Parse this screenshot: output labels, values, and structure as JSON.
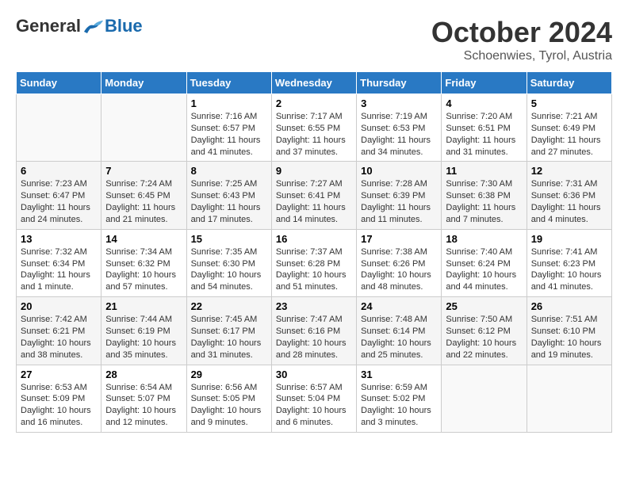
{
  "header": {
    "logo_general": "General",
    "logo_blue": "Blue",
    "month_title": "October 2024",
    "subtitle": "Schoenwies, Tyrol, Austria"
  },
  "days_of_week": [
    "Sunday",
    "Monday",
    "Tuesday",
    "Wednesday",
    "Thursday",
    "Friday",
    "Saturday"
  ],
  "weeks": [
    [
      {
        "day": "",
        "sunrise": "",
        "sunset": "",
        "daylight": ""
      },
      {
        "day": "",
        "sunrise": "",
        "sunset": "",
        "daylight": ""
      },
      {
        "day": "1",
        "sunrise": "Sunrise: 7:16 AM",
        "sunset": "Sunset: 6:57 PM",
        "daylight": "Daylight: 11 hours and 41 minutes."
      },
      {
        "day": "2",
        "sunrise": "Sunrise: 7:17 AM",
        "sunset": "Sunset: 6:55 PM",
        "daylight": "Daylight: 11 hours and 37 minutes."
      },
      {
        "day": "3",
        "sunrise": "Sunrise: 7:19 AM",
        "sunset": "Sunset: 6:53 PM",
        "daylight": "Daylight: 11 hours and 34 minutes."
      },
      {
        "day": "4",
        "sunrise": "Sunrise: 7:20 AM",
        "sunset": "Sunset: 6:51 PM",
        "daylight": "Daylight: 11 hours and 31 minutes."
      },
      {
        "day": "5",
        "sunrise": "Sunrise: 7:21 AM",
        "sunset": "Sunset: 6:49 PM",
        "daylight": "Daylight: 11 hours and 27 minutes."
      }
    ],
    [
      {
        "day": "6",
        "sunrise": "Sunrise: 7:23 AM",
        "sunset": "Sunset: 6:47 PM",
        "daylight": "Daylight: 11 hours and 24 minutes."
      },
      {
        "day": "7",
        "sunrise": "Sunrise: 7:24 AM",
        "sunset": "Sunset: 6:45 PM",
        "daylight": "Daylight: 11 hours and 21 minutes."
      },
      {
        "day": "8",
        "sunrise": "Sunrise: 7:25 AM",
        "sunset": "Sunset: 6:43 PM",
        "daylight": "Daylight: 11 hours and 17 minutes."
      },
      {
        "day": "9",
        "sunrise": "Sunrise: 7:27 AM",
        "sunset": "Sunset: 6:41 PM",
        "daylight": "Daylight: 11 hours and 14 minutes."
      },
      {
        "day": "10",
        "sunrise": "Sunrise: 7:28 AM",
        "sunset": "Sunset: 6:39 PM",
        "daylight": "Daylight: 11 hours and 11 minutes."
      },
      {
        "day": "11",
        "sunrise": "Sunrise: 7:30 AM",
        "sunset": "Sunset: 6:38 PM",
        "daylight": "Daylight: 11 hours and 7 minutes."
      },
      {
        "day": "12",
        "sunrise": "Sunrise: 7:31 AM",
        "sunset": "Sunset: 6:36 PM",
        "daylight": "Daylight: 11 hours and 4 minutes."
      }
    ],
    [
      {
        "day": "13",
        "sunrise": "Sunrise: 7:32 AM",
        "sunset": "Sunset: 6:34 PM",
        "daylight": "Daylight: 11 hours and 1 minute."
      },
      {
        "day": "14",
        "sunrise": "Sunrise: 7:34 AM",
        "sunset": "Sunset: 6:32 PM",
        "daylight": "Daylight: 10 hours and 57 minutes."
      },
      {
        "day": "15",
        "sunrise": "Sunrise: 7:35 AM",
        "sunset": "Sunset: 6:30 PM",
        "daylight": "Daylight: 10 hours and 54 minutes."
      },
      {
        "day": "16",
        "sunrise": "Sunrise: 7:37 AM",
        "sunset": "Sunset: 6:28 PM",
        "daylight": "Daylight: 10 hours and 51 minutes."
      },
      {
        "day": "17",
        "sunrise": "Sunrise: 7:38 AM",
        "sunset": "Sunset: 6:26 PM",
        "daylight": "Daylight: 10 hours and 48 minutes."
      },
      {
        "day": "18",
        "sunrise": "Sunrise: 7:40 AM",
        "sunset": "Sunset: 6:24 PM",
        "daylight": "Daylight: 10 hours and 44 minutes."
      },
      {
        "day": "19",
        "sunrise": "Sunrise: 7:41 AM",
        "sunset": "Sunset: 6:23 PM",
        "daylight": "Daylight: 10 hours and 41 minutes."
      }
    ],
    [
      {
        "day": "20",
        "sunrise": "Sunrise: 7:42 AM",
        "sunset": "Sunset: 6:21 PM",
        "daylight": "Daylight: 10 hours and 38 minutes."
      },
      {
        "day": "21",
        "sunrise": "Sunrise: 7:44 AM",
        "sunset": "Sunset: 6:19 PM",
        "daylight": "Daylight: 10 hours and 35 minutes."
      },
      {
        "day": "22",
        "sunrise": "Sunrise: 7:45 AM",
        "sunset": "Sunset: 6:17 PM",
        "daylight": "Daylight: 10 hours and 31 minutes."
      },
      {
        "day": "23",
        "sunrise": "Sunrise: 7:47 AM",
        "sunset": "Sunset: 6:16 PM",
        "daylight": "Daylight: 10 hours and 28 minutes."
      },
      {
        "day": "24",
        "sunrise": "Sunrise: 7:48 AM",
        "sunset": "Sunset: 6:14 PM",
        "daylight": "Daylight: 10 hours and 25 minutes."
      },
      {
        "day": "25",
        "sunrise": "Sunrise: 7:50 AM",
        "sunset": "Sunset: 6:12 PM",
        "daylight": "Daylight: 10 hours and 22 minutes."
      },
      {
        "day": "26",
        "sunrise": "Sunrise: 7:51 AM",
        "sunset": "Sunset: 6:10 PM",
        "daylight": "Daylight: 10 hours and 19 minutes."
      }
    ],
    [
      {
        "day": "27",
        "sunrise": "Sunrise: 6:53 AM",
        "sunset": "Sunset: 5:09 PM",
        "daylight": "Daylight: 10 hours and 16 minutes."
      },
      {
        "day": "28",
        "sunrise": "Sunrise: 6:54 AM",
        "sunset": "Sunset: 5:07 PM",
        "daylight": "Daylight: 10 hours and 12 minutes."
      },
      {
        "day": "29",
        "sunrise": "Sunrise: 6:56 AM",
        "sunset": "Sunset: 5:05 PM",
        "daylight": "Daylight: 10 hours and 9 minutes."
      },
      {
        "day": "30",
        "sunrise": "Sunrise: 6:57 AM",
        "sunset": "Sunset: 5:04 PM",
        "daylight": "Daylight: 10 hours and 6 minutes."
      },
      {
        "day": "31",
        "sunrise": "Sunrise: 6:59 AM",
        "sunset": "Sunset: 5:02 PM",
        "daylight": "Daylight: 10 hours and 3 minutes."
      },
      {
        "day": "",
        "sunrise": "",
        "sunset": "",
        "daylight": ""
      },
      {
        "day": "",
        "sunrise": "",
        "sunset": "",
        "daylight": ""
      }
    ]
  ]
}
